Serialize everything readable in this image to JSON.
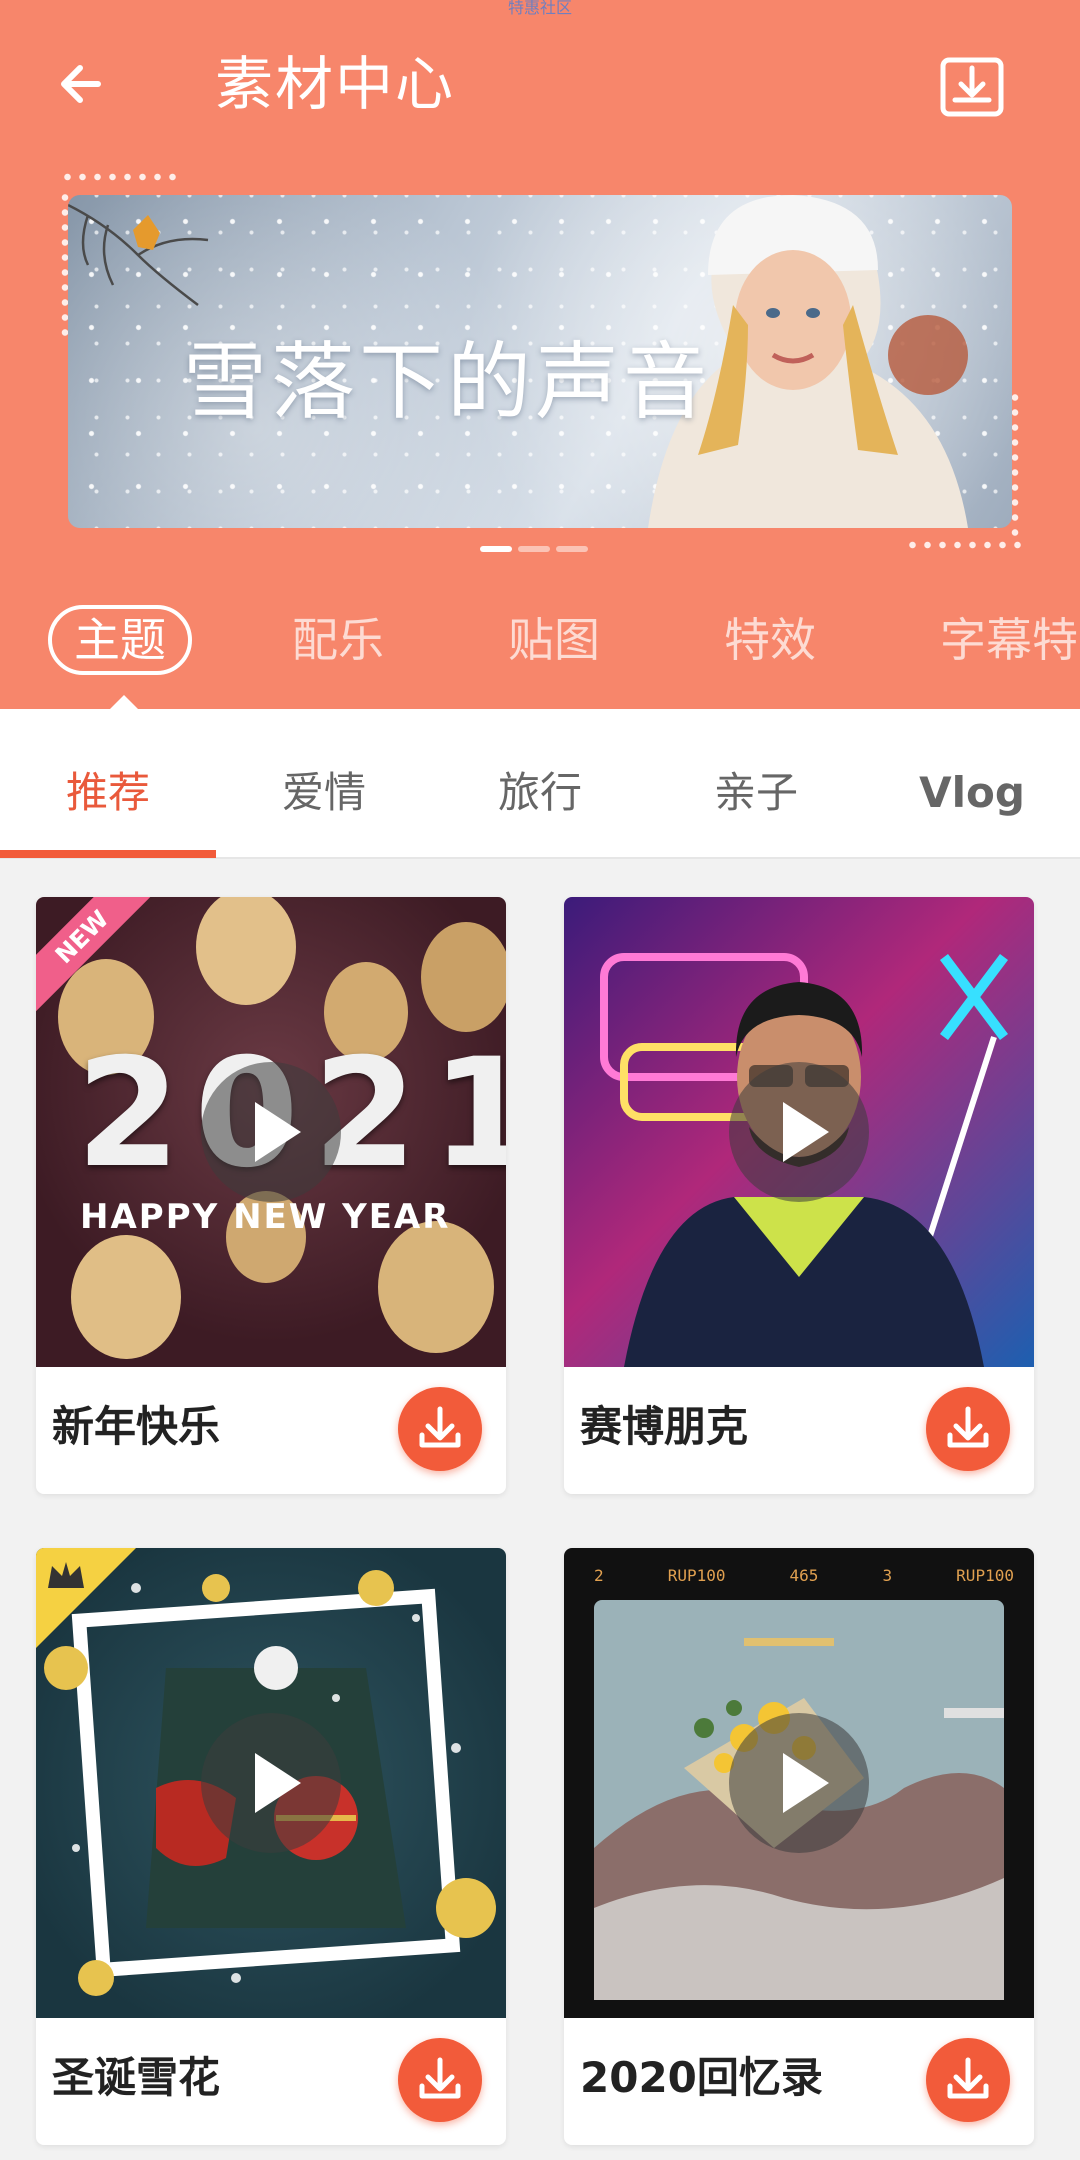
{
  "status_text": "特惠社区",
  "header": {
    "title": "素材中心"
  },
  "banner": {
    "caption": "雪落下的声音"
  },
  "category_tabs": [
    "主题",
    "配乐",
    "贴图",
    "特效",
    "字幕特"
  ],
  "sub_tabs": [
    "推荐",
    "爱情",
    "旅行",
    "亲子",
    "Vlog"
  ],
  "cards": [
    {
      "title": "新年快乐",
      "badge": "NEW",
      "thumb_text_big": "2021",
      "thumb_text_small": "HAPPY NEW YEAR"
    },
    {
      "title": "赛博朋克"
    },
    {
      "title": "圣诞雪花",
      "badge": "crown"
    },
    {
      "title": "2020回忆录",
      "film_labels": [
        "2",
        "RUP100",
        "465",
        "3",
        "RUP100"
      ]
    }
  ],
  "colors": {
    "header_bg": "#f7866b",
    "accent": "#f25b3a",
    "active_sub_tab": "#e9593b"
  }
}
